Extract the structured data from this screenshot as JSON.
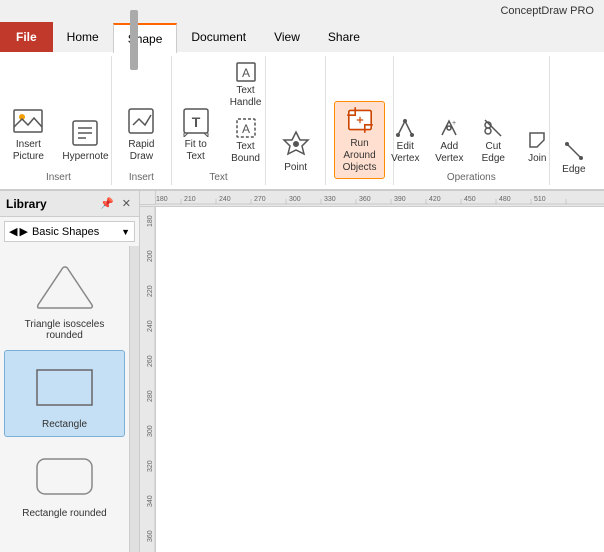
{
  "app": {
    "title": "ConceptDraw PRO"
  },
  "tabs": [
    {
      "id": "file",
      "label": "File"
    },
    {
      "id": "home",
      "label": "Home"
    },
    {
      "id": "shape",
      "label": "Shape"
    },
    {
      "id": "document",
      "label": "Document"
    },
    {
      "id": "view",
      "label": "View"
    },
    {
      "id": "share",
      "label": "Share"
    }
  ],
  "ribbon": {
    "groups": [
      {
        "id": "insert",
        "label": "Insert",
        "items": [
          {
            "id": "insert-picture",
            "label": "Insert\nPicture",
            "large": true
          },
          {
            "id": "hypernote",
            "label": "Hypernote",
            "large": true
          }
        ]
      },
      {
        "id": "rapid-draw",
        "label": "Insert",
        "items": [
          {
            "id": "rapid-draw",
            "label": "Rapid\nDraw",
            "large": true
          }
        ]
      },
      {
        "id": "text",
        "label": "Text",
        "items": [
          {
            "id": "fit-to-text",
            "label": "Fit to\nText",
            "large": true
          },
          {
            "id": "text-handle",
            "label": "Text\nHandle",
            "large": false
          },
          {
            "id": "text-bound",
            "label": "Text\nBound",
            "large": false
          }
        ]
      },
      {
        "id": "point-group",
        "label": "",
        "items": [
          {
            "id": "point",
            "label": "Point",
            "large": true
          }
        ]
      },
      {
        "id": "run-around",
        "label": "",
        "items": [
          {
            "id": "run-around-objects",
            "label": "Run Around\nObjects",
            "large": true,
            "active": true
          }
        ]
      },
      {
        "id": "vertex",
        "label": "Operations",
        "items": [
          {
            "id": "edit-vertex",
            "label": "Edit\nVertex",
            "large": false
          },
          {
            "id": "add-vertex",
            "label": "Add\nVertex",
            "large": false
          },
          {
            "id": "cut-edge",
            "label": "Cut\nEdge",
            "large": false
          },
          {
            "id": "join",
            "label": "Join",
            "large": false
          }
        ]
      }
    ]
  },
  "library": {
    "title": "Library",
    "category": "Basic Shapes",
    "items": [
      {
        "id": "triangle-isosceles-rounded",
        "label": "Triangle isosceles\nrounded"
      },
      {
        "id": "rectangle",
        "label": "Rectangle",
        "selected": true
      },
      {
        "id": "rectangle-rounded",
        "label": "Rectangle rounded"
      }
    ]
  },
  "operations": {
    "edge_label": "Edge"
  }
}
